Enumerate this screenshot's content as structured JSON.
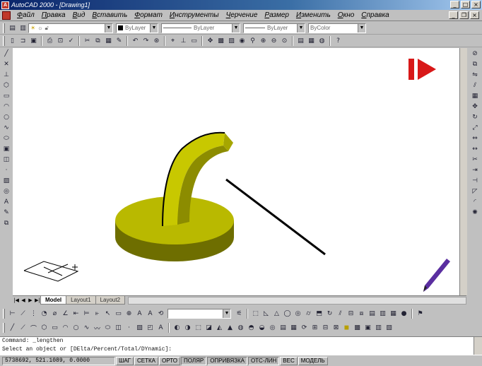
{
  "window": {
    "title": "AutoCAD 2000 - [Drawing1]"
  },
  "menu": {
    "items": [
      "Файл",
      "Правка",
      "Вид",
      "Вставить",
      "Формат",
      "Инструменты",
      "Черчение",
      "Размер",
      "Изменить",
      "Окно",
      "Справка"
    ]
  },
  "toolbar_properties": {
    "layer_combo": "",
    "color_combo": "ByLayer",
    "linetype_combo": "ByLayer",
    "lineweight_combo": "ByLayer",
    "plotstyle_combo": "ByColor"
  },
  "toolbar_standard": {
    "icons": [
      "new-icon",
      "open-icon",
      "save-icon",
      "print-icon",
      "preview-icon",
      "spell-icon",
      "cut-icon",
      "copy-icon",
      "paste-icon",
      "match-icon",
      "undo-icon",
      "redo-icon",
      "hyperlink-icon",
      "snap-icon",
      "ucs-icon",
      "pan-icon",
      "zoom-icon",
      "properties-icon",
      "help-icon"
    ]
  },
  "tabs": {
    "model": "Model",
    "layout1": "Layout1",
    "layout2": "Layout2"
  },
  "command": {
    "line1": "Command: _lengthen",
    "line2": "Select an object or [DElta/Percent/Total/DYnamic]:"
  },
  "status": {
    "coords": "5738692, 521.1089, 0.0000",
    "toggles": [
      "ШАГ",
      "СЕТКА",
      "ОРТО",
      "ПОЛЯР",
      "ОПРИВЯЗКА",
      "ОТС-ЛИН",
      "ВЕС",
      "МОДЕЛЬ"
    ]
  },
  "colors": {
    "titlebar": "#0a246a",
    "canvas": "#ffffff",
    "object_yellow": "#c8c800",
    "object_dark": "#6e6e00"
  }
}
